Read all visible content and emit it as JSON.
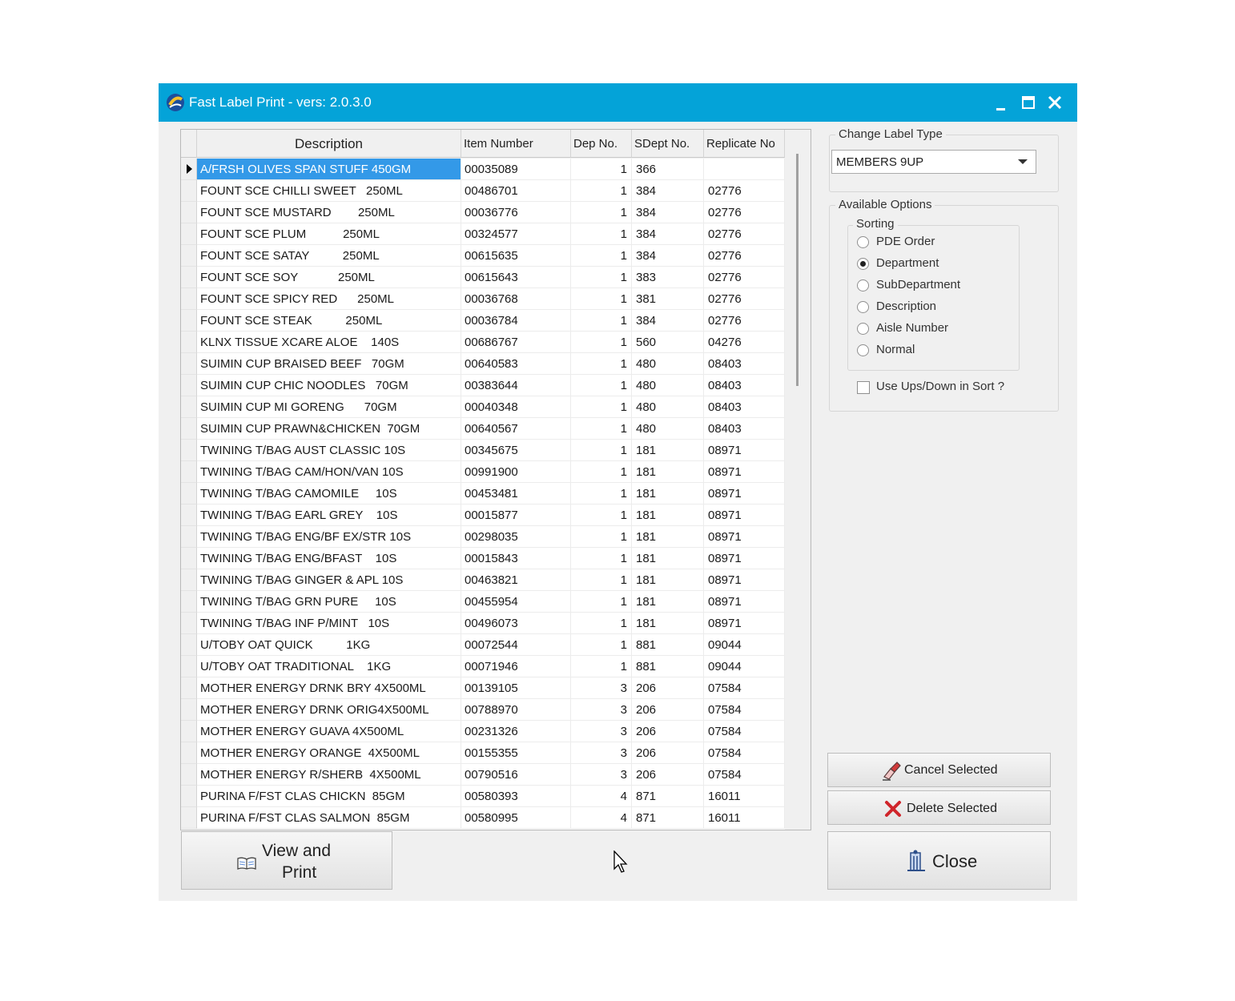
{
  "window": {
    "title": "Fast Label Print - vers: 2.0.3.0"
  },
  "grid": {
    "columns": [
      "Description",
      "Item Number",
      "Dep No.",
      "SDept No.",
      "Replicate No"
    ],
    "rows": [
      [
        "A/FRSH OLIVES SPAN STUFF 450GM",
        "00035089",
        "1",
        "366",
        ""
      ],
      [
        "FOUNT SCE CHILLI SWEET   250ML",
        "00486701",
        "1",
        "384",
        "02776"
      ],
      [
        "FOUNT SCE MUSTARD        250ML",
        "00036776",
        "1",
        "384",
        "02776"
      ],
      [
        "FOUNT SCE PLUM           250ML",
        "00324577",
        "1",
        "384",
        "02776"
      ],
      [
        "FOUNT SCE SATAY          250ML",
        "00615635",
        "1",
        "384",
        "02776"
      ],
      [
        "FOUNT SCE SOY            250ML",
        "00615643",
        "1",
        "383",
        "02776"
      ],
      [
        "FOUNT SCE SPICY RED      250ML",
        "00036768",
        "1",
        "381",
        "02776"
      ],
      [
        "FOUNT SCE STEAK          250ML",
        "00036784",
        "1",
        "384",
        "02776"
      ],
      [
        "KLNX TISSUE XCARE ALOE    140S",
        "00686767",
        "1",
        "560",
        "04276"
      ],
      [
        "SUIMIN CUP BRAISED BEEF   70GM",
        "00640583",
        "1",
        "480",
        "08403"
      ],
      [
        "SUIMIN CUP CHIC NOODLES   70GM",
        "00383644",
        "1",
        "480",
        "08403"
      ],
      [
        "SUIMIN CUP MI GORENG      70GM",
        "00040348",
        "1",
        "480",
        "08403"
      ],
      [
        "SUIMIN CUP PRAWN&CHICKEN  70GM",
        "00640567",
        "1",
        "480",
        "08403"
      ],
      [
        "TWINING T/BAG AUST CLASSIC 10S",
        "00345675",
        "1",
        "181",
        "08971"
      ],
      [
        "TWINING T/BAG CAM/HON/VAN 10S",
        "00991900",
        "1",
        "181",
        "08971"
      ],
      [
        "TWINING T/BAG CAMOMILE     10S",
        "00453481",
        "1",
        "181",
        "08971"
      ],
      [
        "TWINING T/BAG EARL GREY    10S",
        "00015877",
        "1",
        "181",
        "08971"
      ],
      [
        "TWINING T/BAG ENG/BF EX/STR 10S",
        "00298035",
        "1",
        "181",
        "08971"
      ],
      [
        "TWINING T/BAG ENG/BFAST    10S",
        "00015843",
        "1",
        "181",
        "08971"
      ],
      [
        "TWINING T/BAG GINGER & APL 10S",
        "00463821",
        "1",
        "181",
        "08971"
      ],
      [
        "TWINING T/BAG GRN PURE     10S",
        "00455954",
        "1",
        "181",
        "08971"
      ],
      [
        "TWINING T/BAG INF P/MINT   10S",
        "00496073",
        "1",
        "181",
        "08971"
      ],
      [
        "U/TOBY OAT QUICK          1KG",
        "00072544",
        "1",
        "881",
        "09044"
      ],
      [
        "U/TOBY OAT TRADITIONAL    1KG",
        "00071946",
        "1",
        "881",
        "09044"
      ],
      [
        "MOTHER ENERGY DRNK BRY 4X500ML",
        "00139105",
        "3",
        "206",
        "07584"
      ],
      [
        "MOTHER ENERGY DRNK ORIG4X500ML",
        "00788970",
        "3",
        "206",
        "07584"
      ],
      [
        "MOTHER ENERGY GUAVA 4X500ML",
        "00231326",
        "3",
        "206",
        "07584"
      ],
      [
        "MOTHER ENERGY ORANGE  4X500ML",
        "00155355",
        "3",
        "206",
        "07584"
      ],
      [
        "MOTHER ENERGY R/SHERB  4X500ML",
        "00790516",
        "3",
        "206",
        "07584"
      ],
      [
        "PURINA F/FST CLAS CHICKN  85GM",
        "00580393",
        "4",
        "871",
        "16011"
      ],
      [
        "PURINA F/FST CLAS SALMON  85GM",
        "00580995",
        "4",
        "871",
        "16011"
      ]
    ]
  },
  "label_type": {
    "group_label": "Change Label Type",
    "selected": "MEMBERS 9UP"
  },
  "options": {
    "group_label": "Available Options",
    "sorting_label": "Sorting",
    "sorting": [
      {
        "label": "PDE Order",
        "checked": false
      },
      {
        "label": "Department",
        "checked": true
      },
      {
        "label": "SubDepartment",
        "checked": false
      },
      {
        "label": "Description",
        "checked": false
      },
      {
        "label": "Aisle Number",
        "checked": false
      },
      {
        "label": "Normal",
        "checked": false
      }
    ],
    "use_ups_down_label": "Use Ups/Down in Sort ?",
    "use_ups_down_checked": false
  },
  "buttons": {
    "view_print_line1": "View and",
    "view_print_line2": "Print",
    "cancel_selected": "Cancel Selected",
    "delete_selected": "Delete Selected",
    "close": "Close"
  },
  "colors": {
    "titlebar": "#04a3d8",
    "selection": "#3399e8",
    "delete_icon": "#d0252b"
  }
}
